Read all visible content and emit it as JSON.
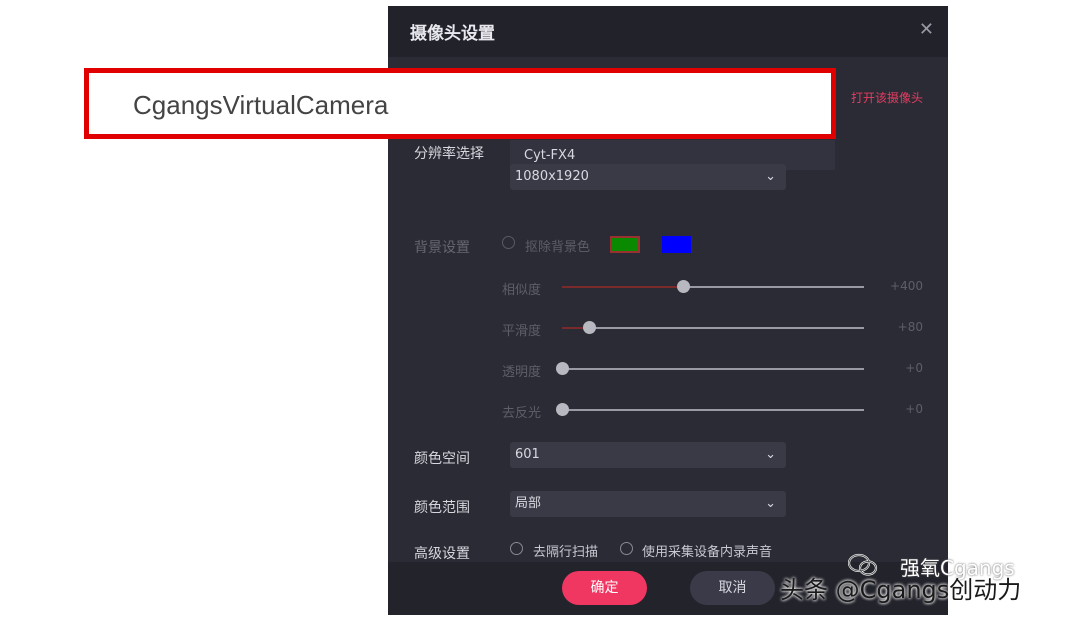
{
  "dialog": {
    "title": "摄像头设置",
    "close_icon": "close-icon",
    "open_camera_link": "打开该摄像头",
    "camera_name": "CgangsVirtualCamera",
    "dropdown_option": "Cyt-FX4",
    "resolution": {
      "label": "分辨率选择",
      "value": "1080x1920"
    },
    "background": {
      "label": "背景设置",
      "keyout_label": "抠除背景色",
      "swatch_colors": [
        "#0a8a00",
        "#0000ff"
      ],
      "sliders": [
        {
          "label": "相似度",
          "value_text": "+400",
          "fraction": 0.4
        },
        {
          "label": "平滑度",
          "value_text": "+80",
          "fraction": 0.09
        },
        {
          "label": "透明度",
          "value_text": "+0",
          "fraction": 0.0
        },
        {
          "label": "去反光",
          "value_text": "+0",
          "fraction": 0.0
        }
      ]
    },
    "color_space": {
      "label": "颜色空间",
      "value": "601"
    },
    "color_range": {
      "label": "颜色范围",
      "value": "局部"
    },
    "advanced": {
      "label": "高级设置",
      "option1": "去隔行扫描",
      "option2": "使用采集设备内录声音"
    },
    "buttons": {
      "ok": "确定",
      "cancel": "取消"
    }
  },
  "watermark": {
    "brand": "强氧Cgangs",
    "byline": "头条 @Cgangs创动力"
  },
  "colors": {
    "accent": "#ef3762",
    "highlight_border": "#e00000"
  }
}
